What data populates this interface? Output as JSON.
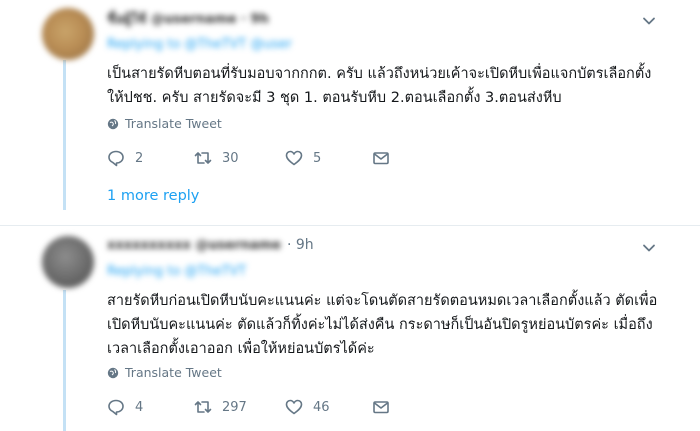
{
  "tweet1": {
    "author_blurred": "ชื่อผู้ใช้ @username · 9h",
    "replying_blurred": "Replying to @TheTVT @user",
    "text": "เป็นสายรัดหีบตอนที่รับมอบจากกกต. ครับ แล้วถึงหน่วยเค้าจะเปิดหีบเพื่อแจกบัตรเลือกตั้ง\nให้ปชช. ครับ สายรัดจะมี 3 ชุด 1. ตอนรับหีบ 2.ตอนเลือกตั้ง 3.ตอนส่งหีบ",
    "translate_label": "Translate Tweet",
    "replies": "2",
    "retweets": "30",
    "likes": "5"
  },
  "more_replies_label": "1 more reply",
  "tweet2": {
    "author_blurred": "xxxxxxxxxx @username",
    "time": "· 9h",
    "replying_blurred": "Replying to @TheTVT",
    "text": "สายรัดหีบก่อนเปิดหีบนับคะแนนค่ะ แต่จะโดนตัดสายรัดตอนหมดเวลาเลือกตั้งแล้ว ตัดเพื่อ\nเปิดหีบนับคะแนนค่ะ ตัดแล้วก็ทิ้งค่ะไม่ได้ส่งคืน กระดาษก็เป็นอันปิดรูหย่อนบัตรค่ะ เมื่อถึง\nเวลาเลือกตั้งเอาออก เพื่อให้หย่อนบัตรได้ค่ะ",
    "translate_label": "Translate Tweet",
    "replies": "4",
    "retweets": "297",
    "likes": "46"
  }
}
